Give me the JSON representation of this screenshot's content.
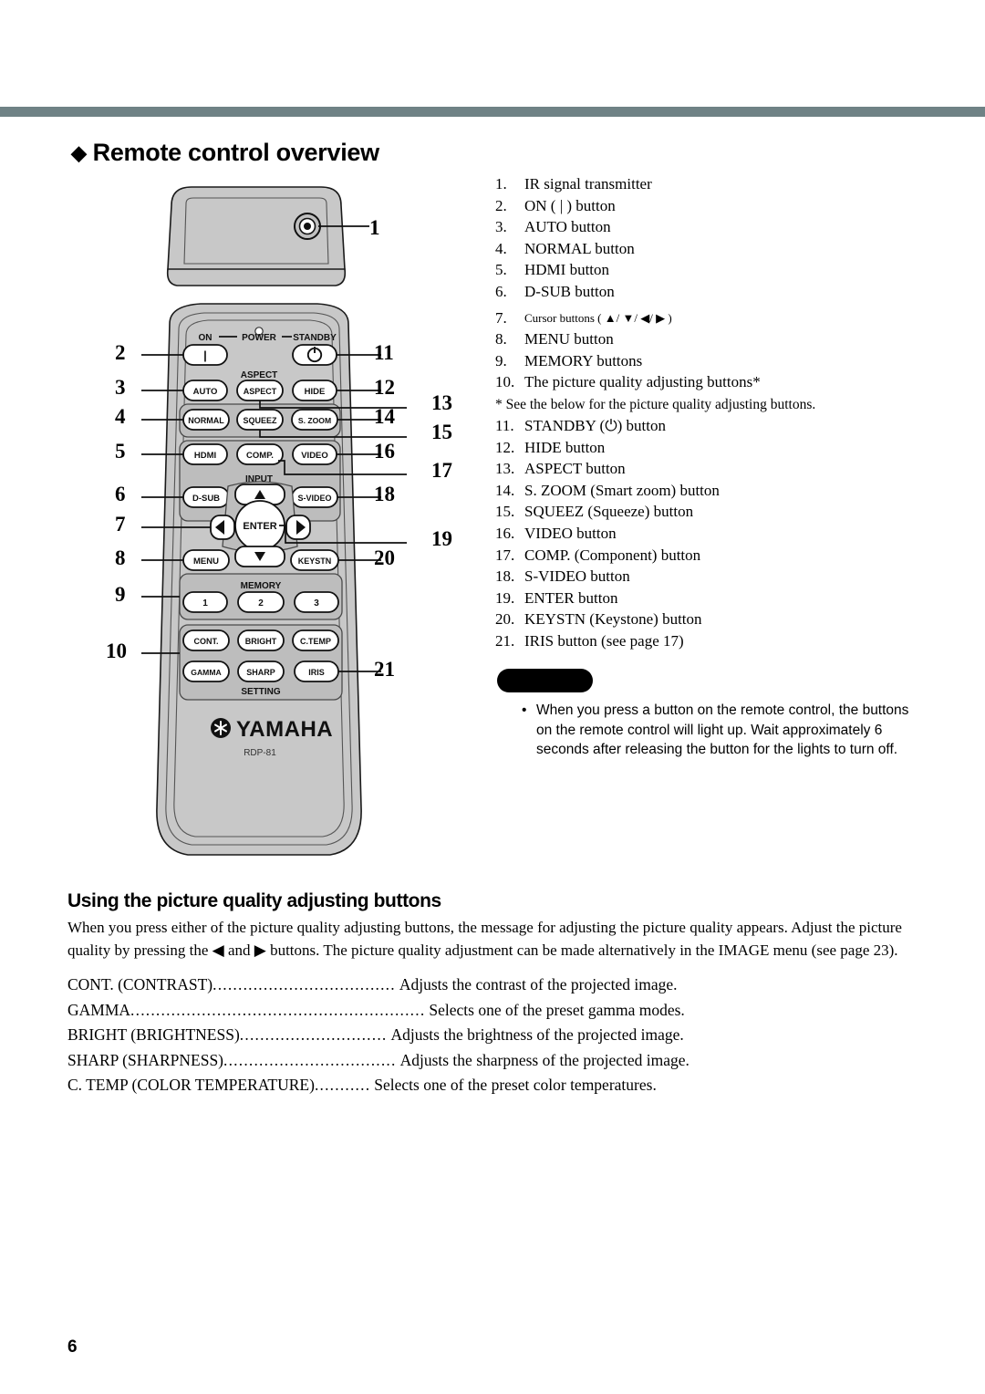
{
  "document": {
    "heading": "Remote control overview",
    "heading_bullet": "◆",
    "page_number": "6"
  },
  "spec_list": {
    "items": [
      {
        "num": "1.",
        "text": "IR signal transmitter"
      },
      {
        "num": "2.",
        "text": "ON ( | ) button"
      },
      {
        "num": "3.",
        "text": "AUTO button"
      },
      {
        "num": "4.",
        "text": "NORMAL button"
      },
      {
        "num": "5.",
        "text": "HDMI button"
      },
      {
        "num": "6.",
        "text": "D-SUB button"
      },
      {
        "num": "7.",
        "text": "Cursor buttons ( ▲/ ▼/ ◀/ ▶ )"
      },
      {
        "num": "8.",
        "text": "MENU button"
      },
      {
        "num": "9.",
        "text": "MEMORY buttons"
      },
      {
        "num": "10.",
        "text": "The picture quality adjusting buttons*"
      }
    ],
    "footnote": "* See the below for the picture quality adjusting buttons.",
    "items2": [
      {
        "num": "11.",
        "text": "STANDBY (⏻) button"
      },
      {
        "num": "12.",
        "text": "HIDE button"
      },
      {
        "num": "13.",
        "text": "ASPECT button"
      },
      {
        "num": "14.",
        "text": "S. ZOOM  (Smart zoom) button"
      },
      {
        "num": "15.",
        "text": "SQUEEZ (Squeeze) button"
      },
      {
        "num": "16.",
        "text": "VIDEO button"
      },
      {
        "num": "17.",
        "text": "COMP. (Component) button"
      },
      {
        "num": "18.",
        "text": "S-VIDEO button"
      },
      {
        "num": "19.",
        "text": "ENTER button"
      },
      {
        "num": "20.",
        "text": "KEYSTN (Keystone) button"
      },
      {
        "num": "21.",
        "text": "IRIS button (see page 17)"
      }
    ]
  },
  "note": {
    "tag_label": "",
    "bullet": "•",
    "text": "When you press a button on the remote control, the buttons on the remote control will light up. Wait approximately 6 seconds after releasing the button for the lights to turn off."
  },
  "subsection": {
    "heading": "Using the picture quality adjusting buttons",
    "paragraph": "When you press either of the picture quality adjusting buttons, the message for adjusting the picture quality appears. Adjust the picture quality by pressing the ◀ and ▶ buttons. The picture quality adjustment can be made alternatively in the IMAGE menu (see page 23)."
  },
  "definitions": [
    {
      "term": "CONT. (CONTRAST)",
      "leader": "....................................",
      "desc": "Adjusts the contrast of the projected image."
    },
    {
      "term": "GAMMA",
      "leader": "..........................................................",
      "desc": "Selects one of the preset gamma modes."
    },
    {
      "term": "BRIGHT (BRIGHTNESS)",
      "leader": ".............................",
      "desc": "Adjusts the brightness of the projected image."
    },
    {
      "term": "SHARP (SHARPNESS)",
      "leader": "..................................",
      "desc": "Adjusts the sharpness of the projected image."
    },
    {
      "term": "C. TEMP (COLOR TEMPERATURE)",
      "leader": "...........",
      "desc": "Selects one of the preset color temperatures."
    }
  ],
  "remote": {
    "brand": "YAMAHA",
    "model": "RDP-81",
    "group_labels": {
      "on": "ON",
      "power": "POWER",
      "standby": "STANDBY",
      "aspect": "ASPECT",
      "input": "INPUT",
      "memory": "MEMORY",
      "setting": "SETTING"
    },
    "buttons": {
      "on": "|",
      "standby": "⏻",
      "auto": "AUTO",
      "aspect": "ASPECT",
      "hide": "HIDE",
      "normal": "NORMAL",
      "squeez": "SQUEEZ",
      "szoom": "S. ZOOM",
      "hdmi": "HDMI",
      "comp": "COMP.",
      "video": "VIDEO",
      "dsub": "D-SUB",
      "svideo": "S-VIDEO",
      "enter": "ENTER",
      "menu": "MENU",
      "keystn": "KEYSTN",
      "mem1": "1",
      "mem2": "2",
      "mem3": "3",
      "cont": "CONT.",
      "bright": "BRIGHT",
      "ctemp": "C.TEMP",
      "gamma": "GAMMA",
      "sharp": "SHARP",
      "iris": "IRIS",
      "up": "▲",
      "down": "▼",
      "left": "◀",
      "right": "▶"
    },
    "callouts_left": [
      "1",
      "2",
      "3",
      "4",
      "5",
      "6",
      "7",
      "8",
      "9",
      "10"
    ],
    "callouts_right": [
      "11",
      "12",
      "13",
      "14",
      "15",
      "16",
      "17",
      "18",
      "19",
      "20",
      "21"
    ]
  },
  "colors": {
    "rule": "#6f8285",
    "body_shell": "#c8c8c8",
    "panel_inset": "#bdbdbd",
    "button_face": "#ffffff",
    "outline": "#1a1a1a"
  }
}
